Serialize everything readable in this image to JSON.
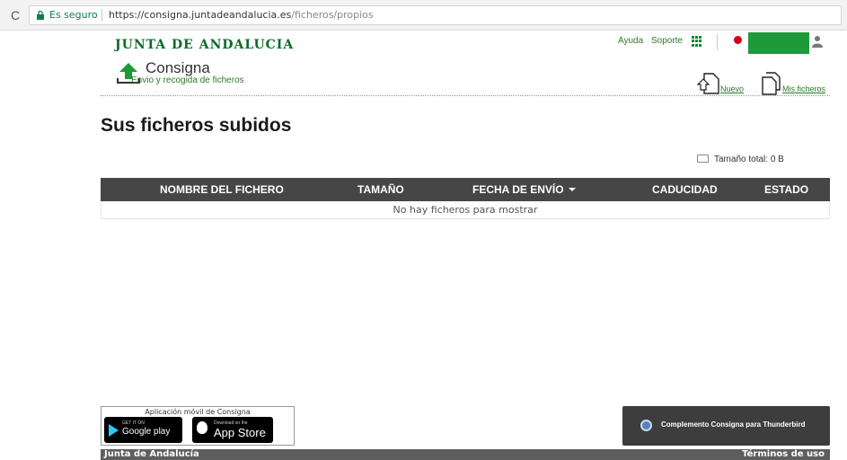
{
  "browser": {
    "secure_label": "Es seguro",
    "url_main": "https://consigna.juntadeandalucia.es",
    "url_path": "/ficheros/propios"
  },
  "header": {
    "brand": "JUNTA DE ANDALUCIA",
    "help": "Ayuda",
    "support": "Soporte",
    "app_title": "Consigna",
    "app_subtitle": "Envio y recogida de ficheros",
    "new_label": "Nuevo",
    "my_files_label": "Mis ficheros"
  },
  "main": {
    "title": "Sus ficheros subidos",
    "total_size": "Tamaño total: 0 B"
  },
  "table": {
    "columns": [
      "NOMBRE DEL FICHERO",
      "TAMAÑO",
      "FECHA DE ENVÍO",
      "CADUCIDAD",
      "ESTADO"
    ],
    "empty_message": "No hay ficheros para mostrar"
  },
  "footer": {
    "mobile_app_label": "Aplicación móvil de Consigna",
    "google_small": "GET IT ON",
    "google_big": "Google play",
    "apple_small": "Download on the",
    "apple_big": "App Store",
    "thunderbird": "Complemento Consigna para Thunderbird",
    "org": "Junta de Andalucía",
    "terms": "Términos de uso"
  },
  "colors": {
    "brand_green": "#0b6b2a",
    "link_green": "#2a7a2a",
    "table_header": "#464646",
    "user_block": "#1f9a3b"
  }
}
